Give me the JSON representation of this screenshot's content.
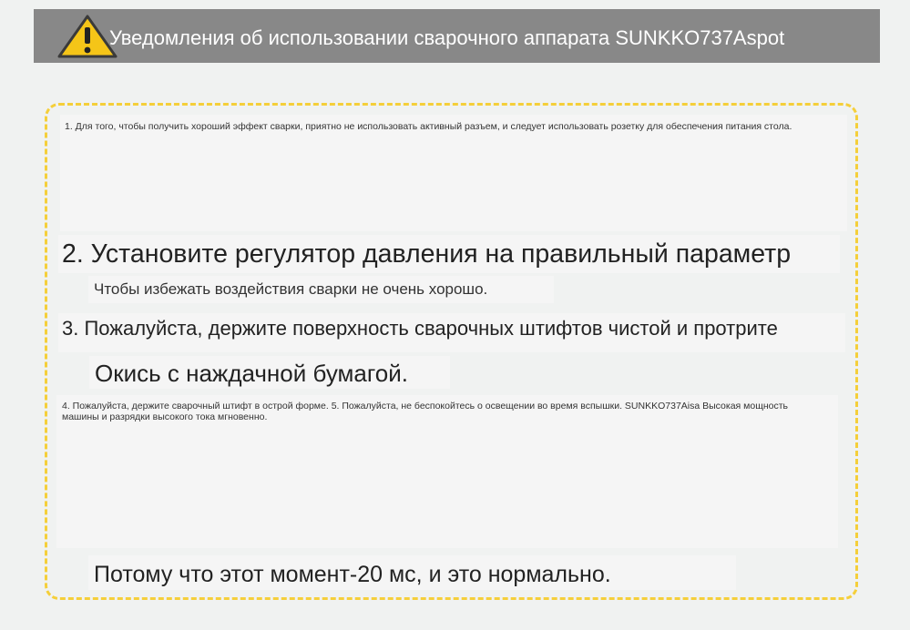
{
  "header": {
    "title": "Уведомления об использовании сварочного аппарата SUNKKO737Aspot",
    "icon": "warning-icon",
    "icon_color": "#f5c518"
  },
  "notes": {
    "note1": "1. Для того, чтобы получить хороший эффект сварки, приятно не использовать активный разъем, и следует использовать розетку для обеспечения питания стола.",
    "note2_heading": "2. Установите регулятор давления на правильный параметр",
    "note2_sub": "Чтобы избежать воздействия сварки не очень хорошо.",
    "note3_heading": "3. Пожалуйста, держите поверхность сварочных штифтов чистой и протрите",
    "note3_sub": "Окись с наждачной бумагой.",
    "note45": "4. Пожалуйста, держите сварочный штифт в острой форме. 5. Пожалуйста, не беспокойтесь о освещении во время вспышки. SUNKKO737Aisa Высокая мощность машины и разрядки высокого тока мгновенно.",
    "final": "Потому что этот момент-20 мс, и это нормально."
  },
  "colors": {
    "header_bg": "#888888",
    "frame_border": "#f5cf3a",
    "page_bg": "#f0f2f1"
  }
}
